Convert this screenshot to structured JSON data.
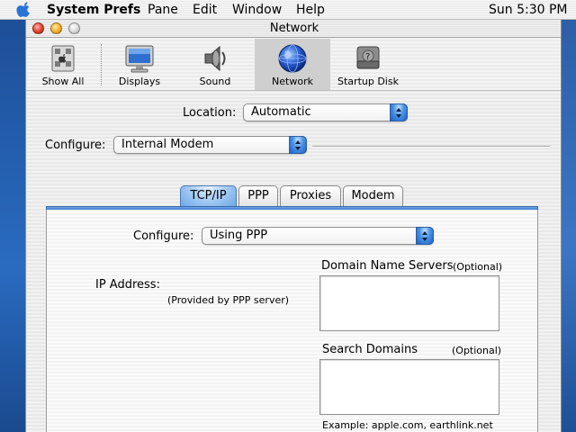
{
  "menubar": {
    "app": "System Prefs",
    "items": [
      "Pane",
      "Edit",
      "Window",
      "Help"
    ],
    "clock": "Sun 5:30 PM"
  },
  "window": {
    "title": "Network"
  },
  "toolbar": {
    "items": [
      {
        "label": "Show All",
        "icon": "show-all-icon"
      },
      {
        "label": "Displays",
        "icon": "displays-icon"
      },
      {
        "label": "Sound",
        "icon": "sound-icon"
      },
      {
        "label": "Network",
        "icon": "network-globe-icon"
      },
      {
        "label": "Startup Disk",
        "icon": "startup-disk-icon"
      }
    ],
    "selected": "Network"
  },
  "location": {
    "label": "Location:",
    "value": "Automatic"
  },
  "configure_top": {
    "label": "Configure:",
    "value": "Internal Modem"
  },
  "tabs": [
    {
      "label": "TCP/IP",
      "active": true
    },
    {
      "label": "PPP",
      "active": false
    },
    {
      "label": "Proxies",
      "active": false
    },
    {
      "label": "Modem",
      "active": false
    }
  ],
  "tcpip": {
    "configure_label": "Configure:",
    "configure_value": "Using PPP",
    "ip_label": "IP Address:",
    "ip_note": "(Provided by PPP server)",
    "dns_label": "Domain Name Servers",
    "dns_optional": "(Optional)",
    "dns_value": "",
    "search_label": "Search Domains",
    "search_optional": "(Optional)",
    "search_value": "",
    "example": "Example: apple.com, earthlink.net"
  },
  "colors": {
    "accent": "#3f7ed0",
    "desktop": "#1f5aa8",
    "close": "#e0402b",
    "minimize": "#f2b12a"
  }
}
